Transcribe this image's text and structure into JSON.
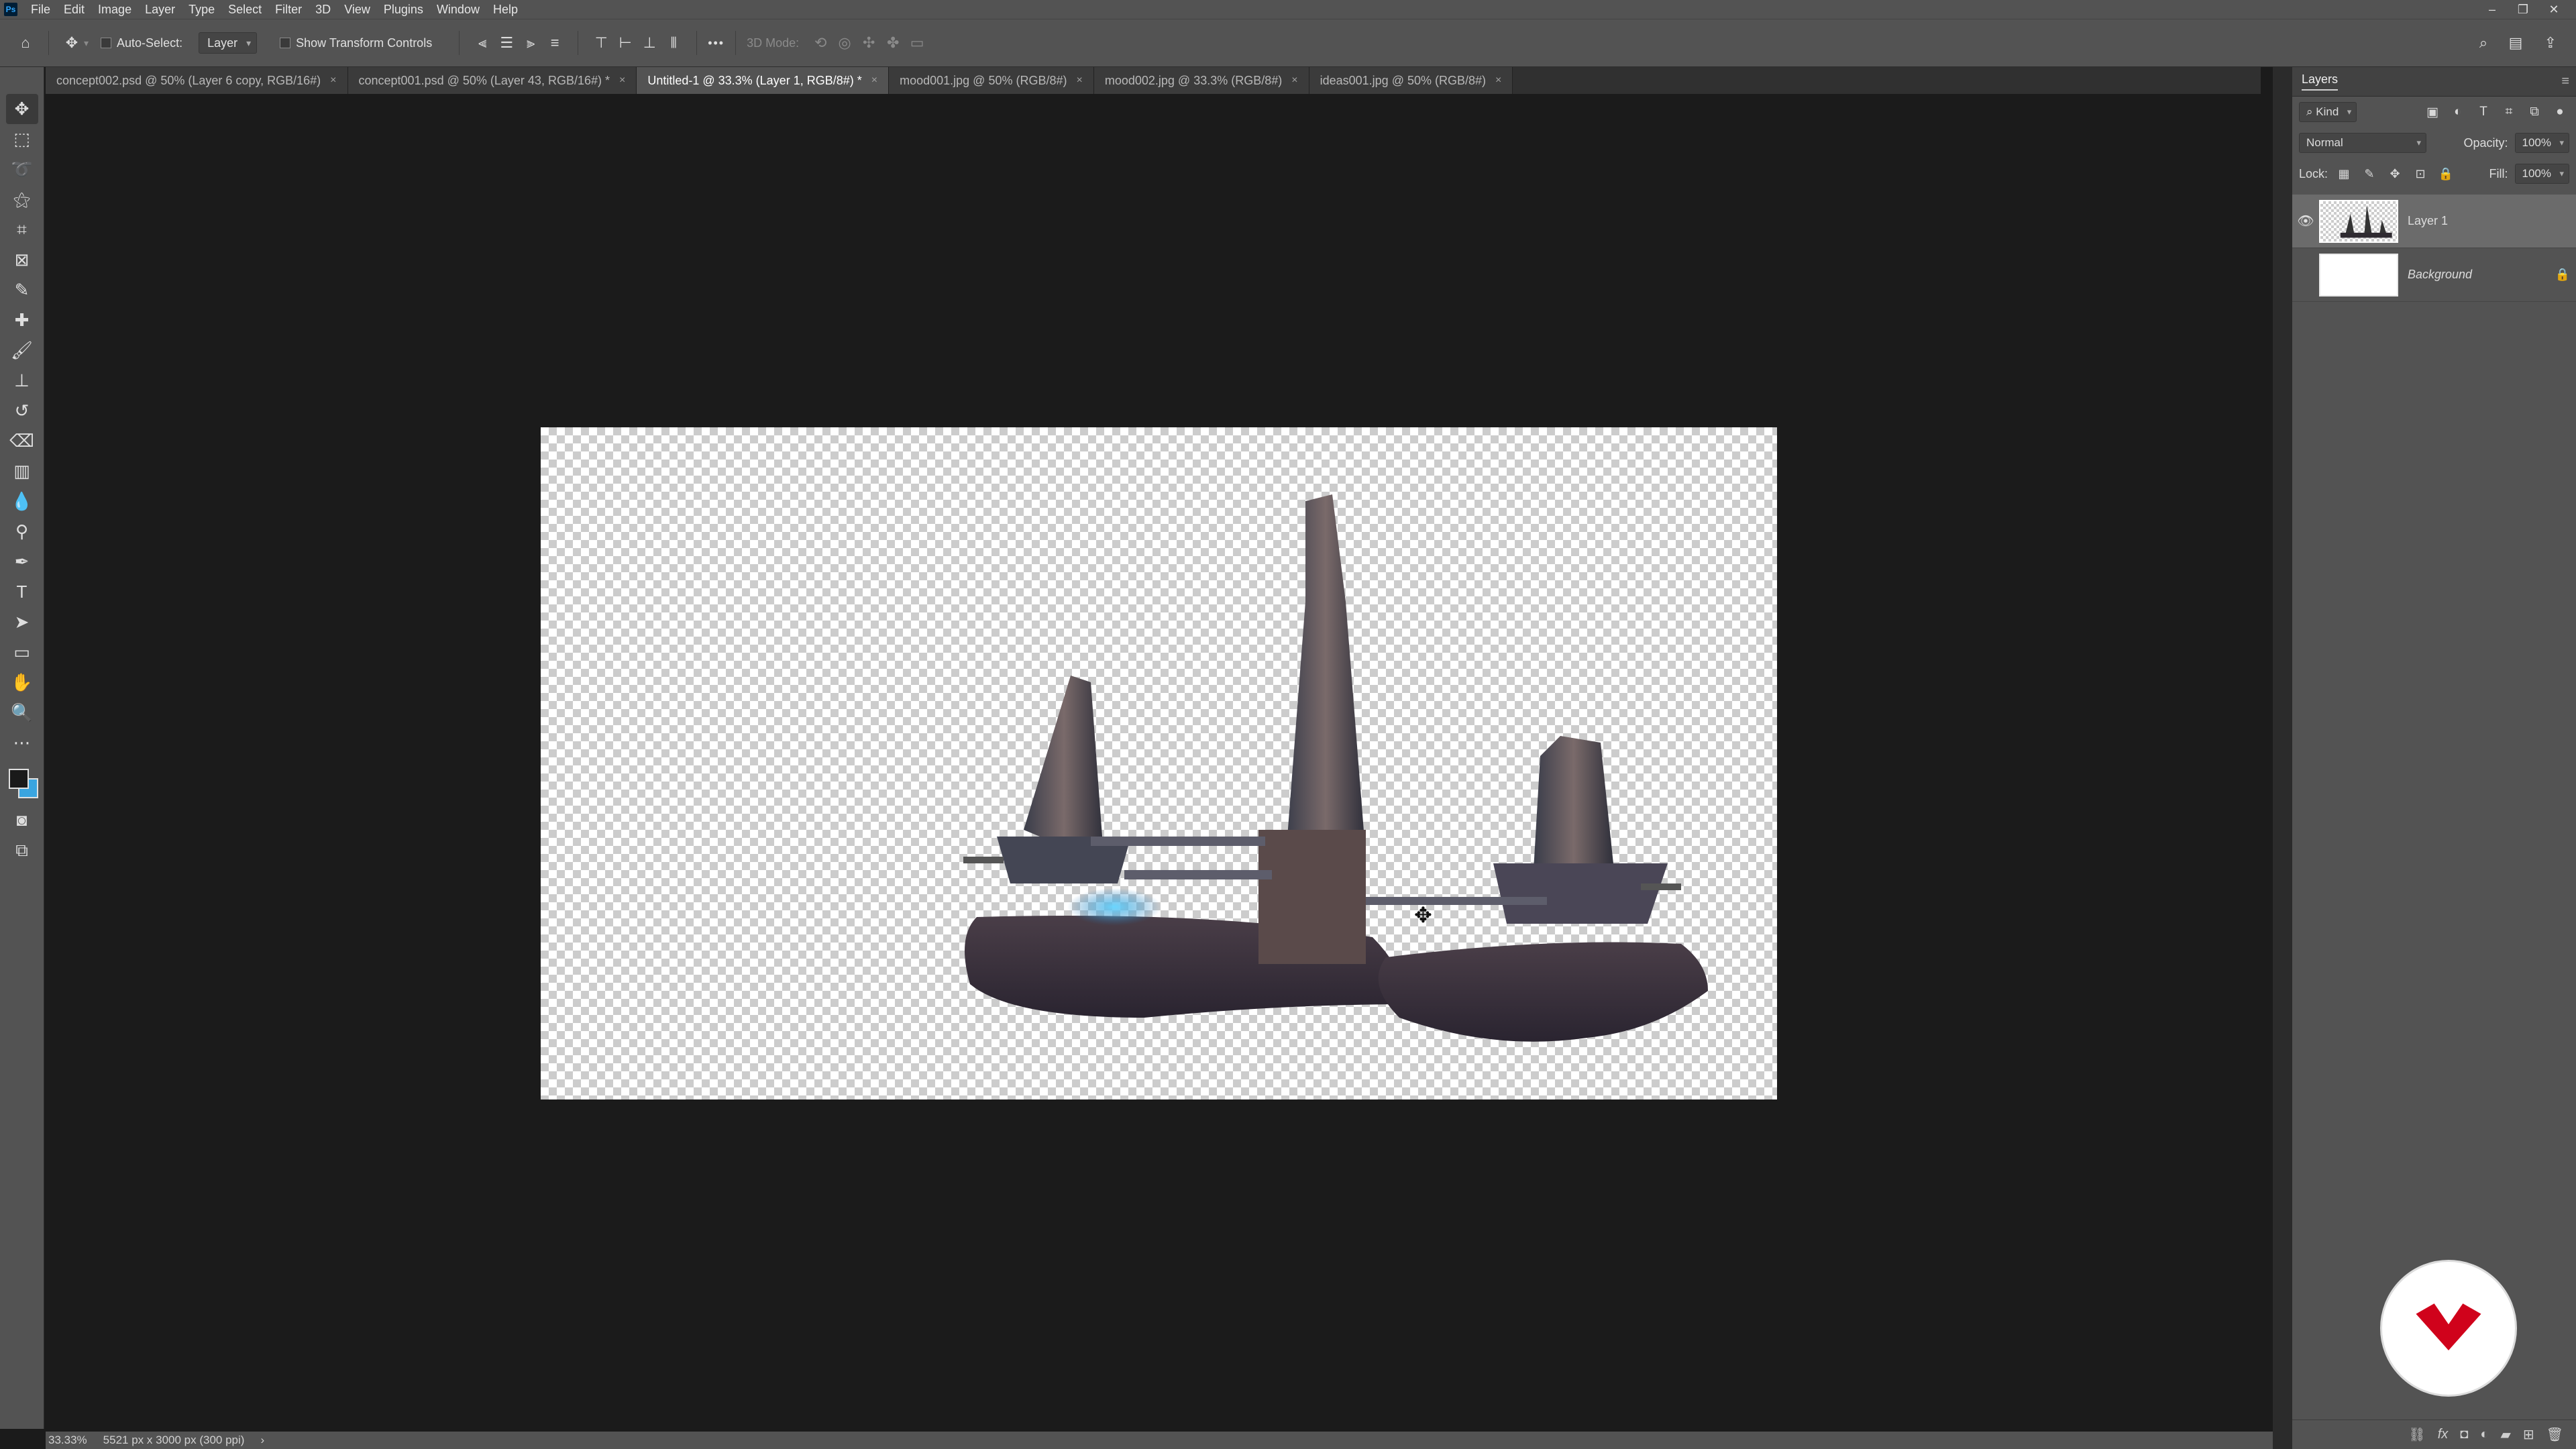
{
  "app": {
    "logo": "Ps"
  },
  "menu": [
    "File",
    "Edit",
    "Image",
    "Layer",
    "Type",
    "Select",
    "Filter",
    "3D",
    "View",
    "Plugins",
    "Window",
    "Help"
  ],
  "window_controls": [
    "–",
    "❐",
    "✕"
  ],
  "options": {
    "auto_select_label": "Auto-Select:",
    "auto_select_target": "Layer",
    "show_transform_label": "Show Transform Controls",
    "mode_3d_label": "3D Mode:",
    "more_label": "•••"
  },
  "tabs": [
    {
      "label": "concept002.psd @ 50% (Layer 6 copy, RGB/16#)",
      "active": false
    },
    {
      "label": "concept001.psd @ 50% (Layer 43, RGB/16#) *",
      "active": false
    },
    {
      "label": "Untitled-1 @ 33.3% (Layer 1, RGB/8#) *",
      "active": true
    },
    {
      "label": "mood001.jpg @ 50% (RGB/8#)",
      "active": false
    },
    {
      "label": "mood002.jpg @ 33.3% (RGB/8#)",
      "active": false
    },
    {
      "label": "ideas001.jpg @ 50% (RGB/8#)",
      "active": false
    }
  ],
  "tab_close": "×",
  "status": {
    "zoom": "33.33%",
    "doc_info": "5521 px x 3000 px (300 ppi)",
    "arrow": "›"
  },
  "layers_panel": {
    "title": "Layers",
    "filter_kind": "Kind",
    "blend_mode": "Normal",
    "opacity_label": "Opacity:",
    "opacity_value": "100%",
    "lock_label": "Lock:",
    "fill_label": "Fill:",
    "fill_value": "100%",
    "layers": [
      {
        "name": "Layer 1",
        "visible": true,
        "selected": true,
        "locked": false
      },
      {
        "name": "Background",
        "visible": false,
        "selected": false,
        "locked": true
      }
    ]
  },
  "colors": {
    "foreground": "#1a1a1a",
    "background": "#3aa5e0",
    "ui_panel": "#535353",
    "workspace": "#1b1b1b",
    "watermark_red": "#d0021b"
  }
}
